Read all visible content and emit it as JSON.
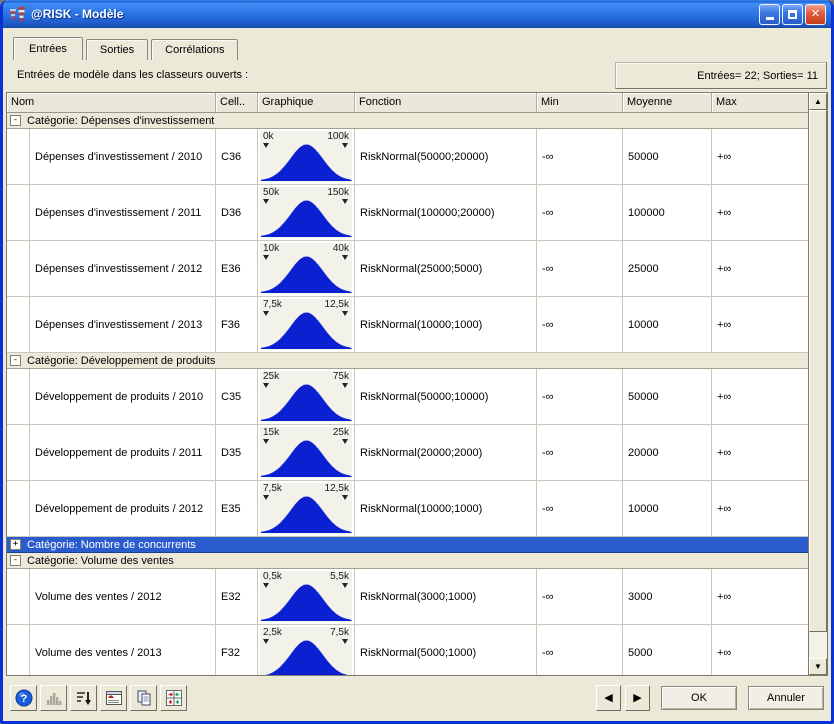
{
  "window": {
    "title": "@RISK - Modèle",
    "controls": {
      "minimize": "minimize-icon",
      "maximize": "maximize-icon",
      "close": "close-icon"
    }
  },
  "colors": {
    "titlebar_blue": "#2A70E2",
    "window_border": "#0831D9",
    "background": "#ECE9D8",
    "selection_blue": "#2B5CCE",
    "graph_blue": "#0B20D0",
    "close_red": "#E0593A"
  },
  "tabs": [
    {
      "label": "Entrées",
      "active": true
    },
    {
      "label": "Sorties",
      "active": false
    },
    {
      "label": "Corrélations",
      "active": false
    }
  ],
  "infobar": {
    "left": "Entrées de modèle dans les classeurs ouverts :",
    "right": "Entrées= 22; Sorties= 11"
  },
  "table": {
    "columns": [
      "Nom",
      "Cell..",
      "Graphique",
      "Fonction",
      "Min",
      "Moyenne",
      "Max"
    ],
    "groups": [
      {
        "label": "Catégorie: Dépenses d'investissement",
        "expanded": true,
        "selected": false,
        "rows": [
          {
            "nom": "Dépenses d'investissement / 2010",
            "cell": "C36",
            "graph_min": "0k",
            "graph_max": "100k",
            "fonction": "RiskNormal(50000;20000)",
            "min": "-∞",
            "moyenne": "50000",
            "max": "+∞"
          },
          {
            "nom": "Dépenses d'investissement / 2011",
            "cell": "D36",
            "graph_min": "50k",
            "graph_max": "150k",
            "fonction": "RiskNormal(100000;20000)",
            "min": "-∞",
            "moyenne": "100000",
            "max": "+∞"
          },
          {
            "nom": "Dépenses d'investissement / 2012",
            "cell": "E36",
            "graph_min": "10k",
            "graph_max": "40k",
            "fonction": "RiskNormal(25000;5000)",
            "min": "-∞",
            "moyenne": "25000",
            "max": "+∞"
          },
          {
            "nom": "Dépenses d'investissement / 2013",
            "cell": "F36",
            "graph_min": "7,5k",
            "graph_max": "12,5k",
            "fonction": "RiskNormal(10000;1000)",
            "min": "-∞",
            "moyenne": "10000",
            "max": "+∞"
          }
        ]
      },
      {
        "label": "Catégorie: Développement de produits",
        "expanded": true,
        "selected": false,
        "rows": [
          {
            "nom": "Développement de produits / 2010",
            "cell": "C35",
            "graph_min": "25k",
            "graph_max": "75k",
            "fonction": "RiskNormal(50000;10000)",
            "min": "-∞",
            "moyenne": "50000",
            "max": "+∞"
          },
          {
            "nom": "Développement de produits / 2011",
            "cell": "D35",
            "graph_min": "15k",
            "graph_max": "25k",
            "fonction": "RiskNormal(20000;2000)",
            "min": "-∞",
            "moyenne": "20000",
            "max": "+∞"
          },
          {
            "nom": "Développement de produits / 2012",
            "cell": "E35",
            "graph_min": "7,5k",
            "graph_max": "12,5k",
            "fonction": "RiskNormal(10000;1000)",
            "min": "-∞",
            "moyenne": "10000",
            "max": "+∞"
          }
        ]
      },
      {
        "label": "Catégorie: Nombre de concurrents",
        "expanded": false,
        "selected": true,
        "rows": []
      },
      {
        "label": "Catégorie: Volume des ventes",
        "expanded": true,
        "selected": false,
        "rows": [
          {
            "nom": "Volume des ventes / 2012",
            "cell": "E32",
            "graph_min": "0,5k",
            "graph_max": "5,5k",
            "fonction": "RiskNormal(3000;1000)",
            "min": "-∞",
            "moyenne": "3000",
            "max": "+∞"
          },
          {
            "nom": "Volume des ventes / 2013",
            "cell": "F32",
            "graph_min": "2,5k",
            "graph_max": "7,5k",
            "fonction": "RiskNormal(5000;1000)",
            "min": "-∞",
            "moyenne": "5000",
            "max": "+∞"
          }
        ]
      }
    ]
  },
  "toolbar": {
    "icons": [
      "help-icon",
      "histogram-icon",
      "sort-icon",
      "report-icon",
      "copy-icon",
      "excel-grid-icon"
    ]
  },
  "footer": {
    "prev": "◀",
    "next": "▶",
    "ok_label": "OK",
    "cancel_label": "Annuler"
  }
}
